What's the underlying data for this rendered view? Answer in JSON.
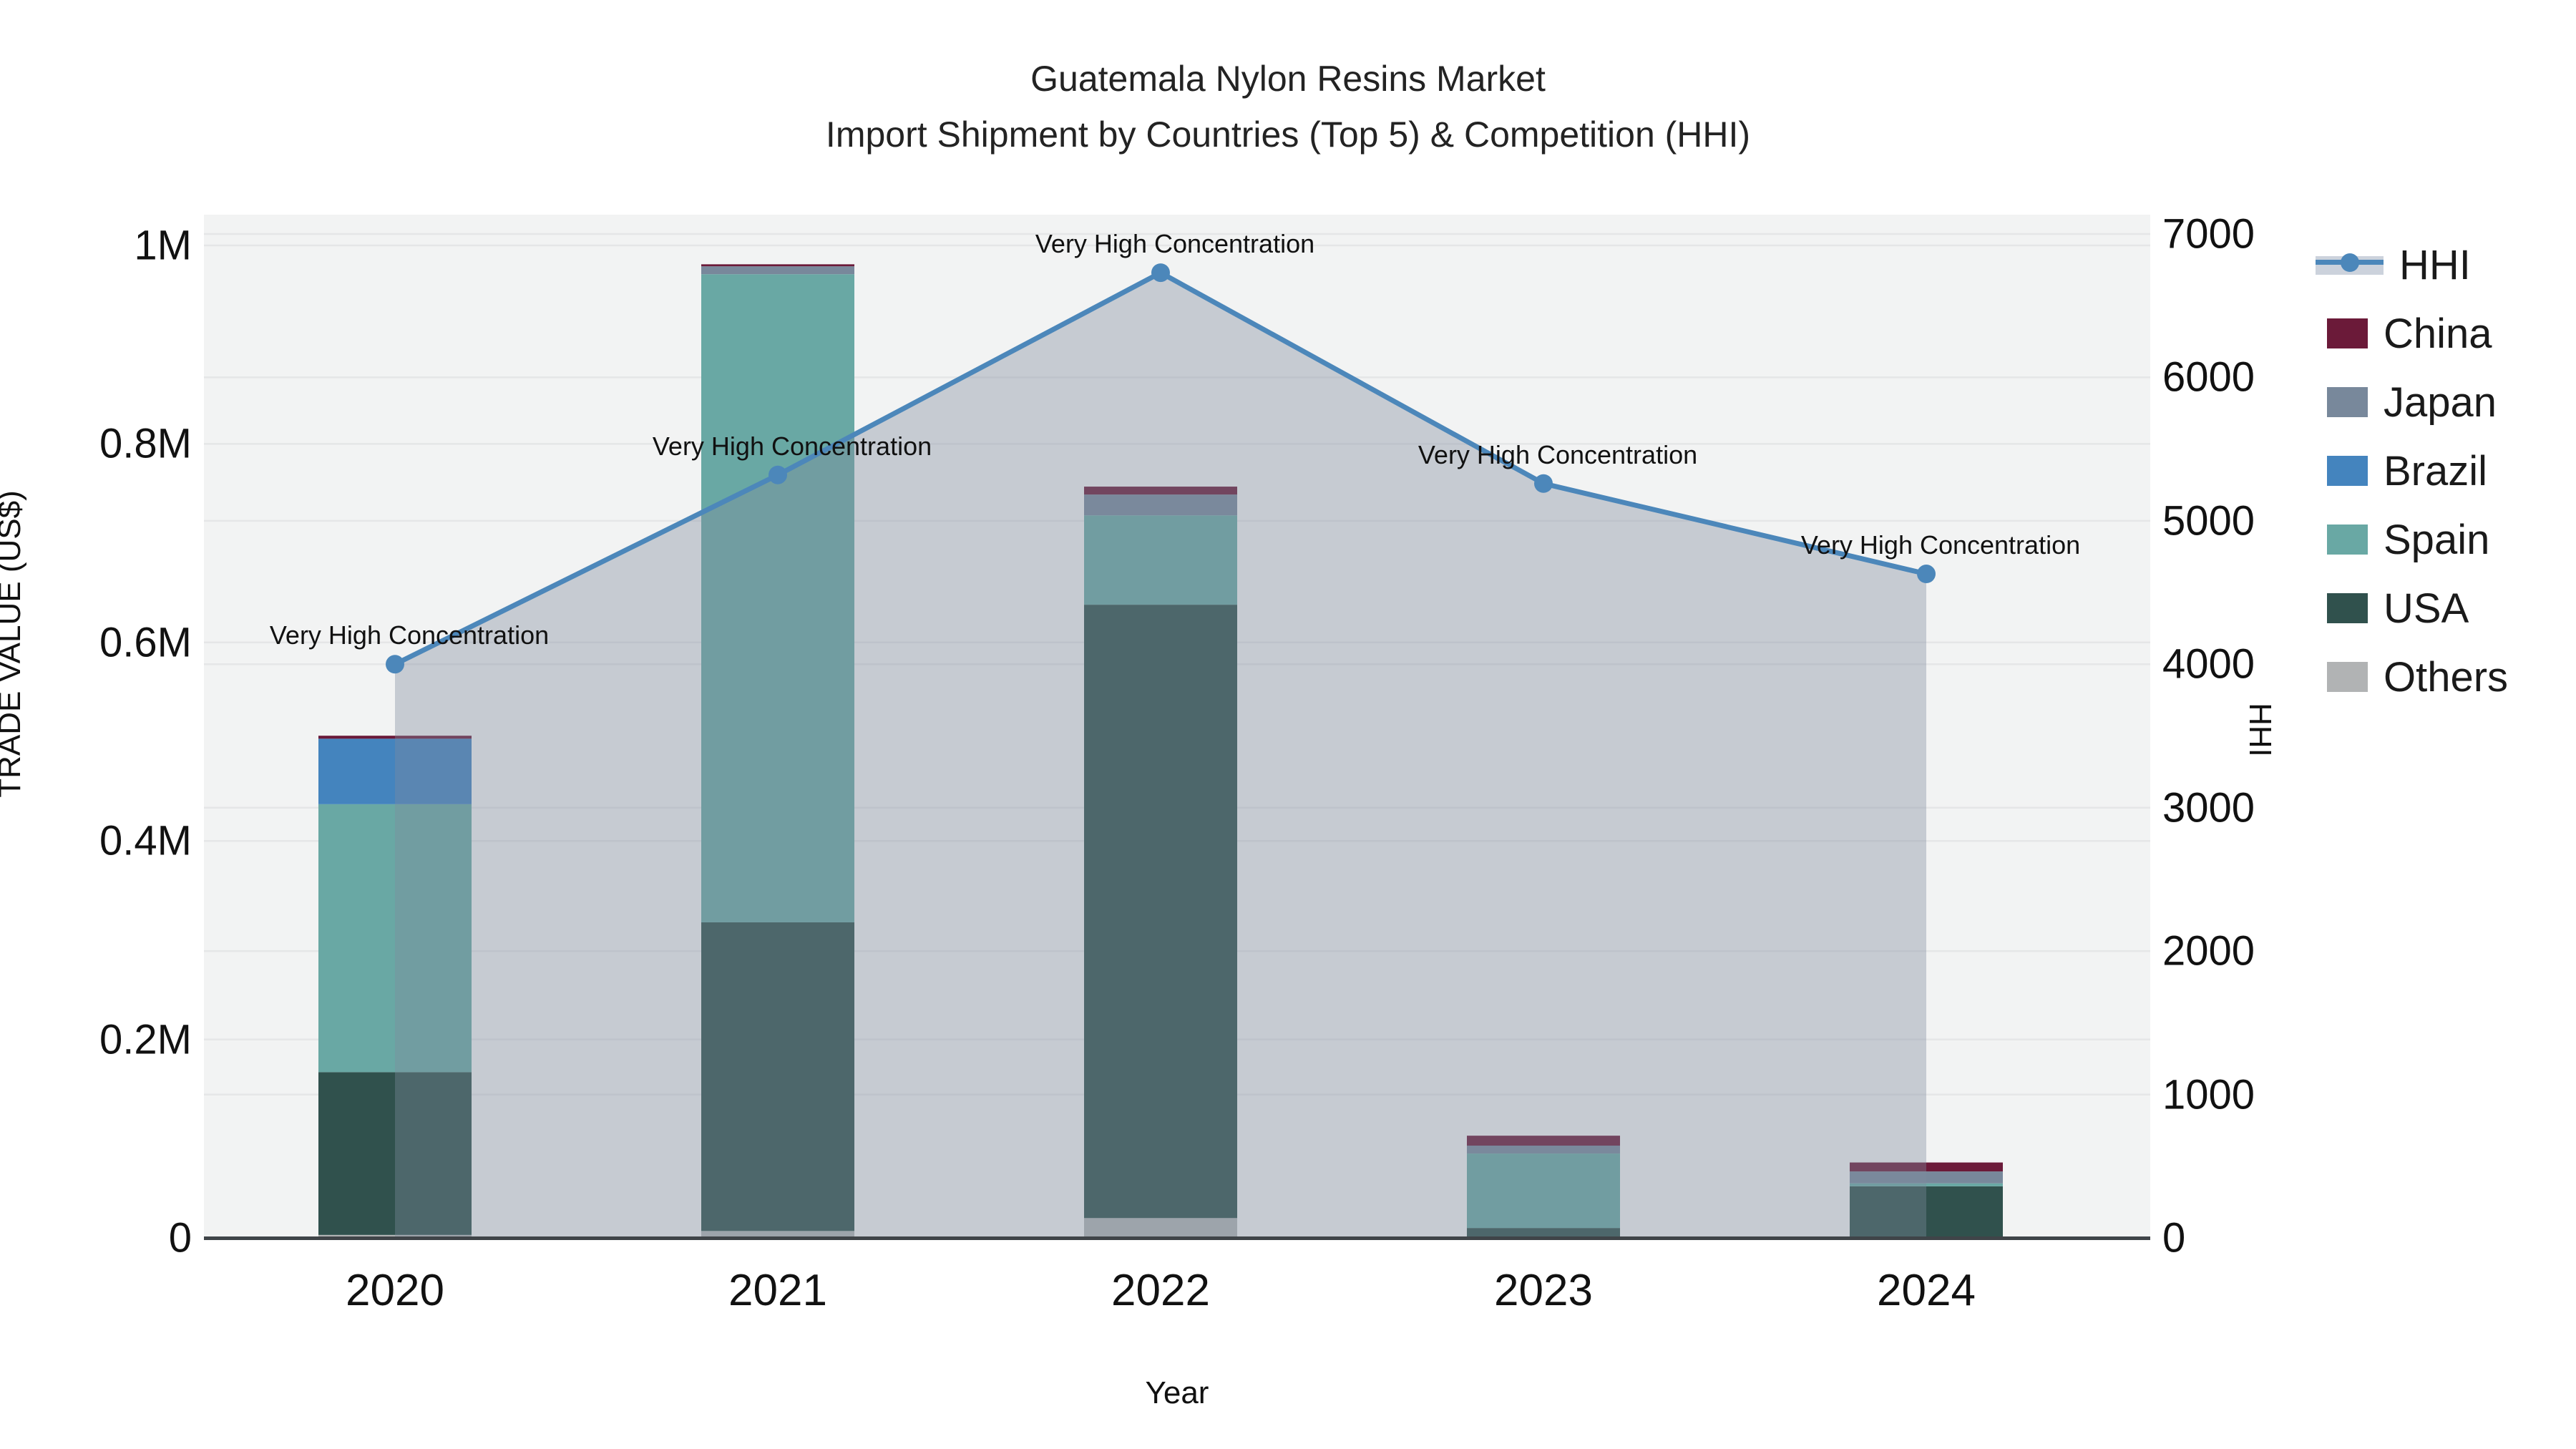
{
  "title": {
    "line1": "Guatemala Nylon Resins Market",
    "line2": "Import Shipment by Countries (Top 5) & Competition (HHI)"
  },
  "axes": {
    "left": {
      "title": "TRADE VALUE (US$)",
      "ticks": [
        "0",
        "0.2M",
        "0.4M",
        "0.6M",
        "0.8M",
        "1M"
      ],
      "tick_values": [
        0,
        200000,
        400000,
        600000,
        800000,
        1000000
      ]
    },
    "right": {
      "title": "HHI",
      "ticks": [
        "0",
        "1000",
        "2000",
        "3000",
        "4000",
        "5000",
        "6000",
        "7000"
      ],
      "tick_values": [
        0,
        1000,
        2000,
        3000,
        4000,
        5000,
        6000,
        7000
      ]
    },
    "x": {
      "title": "Year",
      "ticks": [
        "2020",
        "2021",
        "2022",
        "2023",
        "2024"
      ]
    }
  },
  "legend": {
    "items": [
      {
        "label": "HHI",
        "color": "#4c87ba",
        "type": "line",
        "band_color": "#ccd2dc"
      },
      {
        "label": "China",
        "color": "#6b1a39",
        "type": "swatch"
      },
      {
        "label": "Japan",
        "color": "#78889b",
        "type": "swatch"
      },
      {
        "label": "Brazil",
        "color": "#4484be",
        "type": "swatch"
      },
      {
        "label": "Spain",
        "color": "#69a8a4",
        "type": "swatch"
      },
      {
        "label": "USA",
        "color": "#30514d",
        "type": "swatch"
      },
      {
        "label": "Others",
        "color": "#b1b3b4",
        "type": "swatch"
      }
    ]
  },
  "chart_data": {
    "type": "bar",
    "subtype": "stacked-bars-with-line-overlay",
    "title": "Guatemala Nylon Resins Market — Import Shipment by Countries (Top 5) & Competition (HHI)",
    "categories": [
      "2020",
      "2021",
      "2022",
      "2023",
      "2024"
    ],
    "series": [
      {
        "name": "China",
        "color": "#6b1a39",
        "values": [
          3000,
          2000,
          8000,
          10000,
          9000
        ]
      },
      {
        "name": "Japan",
        "color": "#78889b",
        "values": [
          0,
          8000,
          21000,
          8000,
          12000
        ]
      },
      {
        "name": "Brazil",
        "color": "#4484be",
        "values": [
          66000,
          0,
          0,
          0,
          0
        ]
      },
      {
        "name": "Spain",
        "color": "#69a8a4",
        "values": [
          270000,
          653000,
          90000,
          75000,
          3000
        ]
      },
      {
        "name": "USA",
        "color": "#30514d",
        "values": [
          164000,
          311000,
          618000,
          9000,
          52000
        ]
      },
      {
        "name": "Others",
        "color": "#b1b3b4",
        "values": [
          3000,
          7000,
          20000,
          1000,
          0
        ]
      }
    ],
    "stack_order_bottom_to_top": [
      "Others",
      "USA",
      "Spain",
      "Brazil",
      "Japan",
      "China"
    ],
    "bar_totals": [
      506000,
      981000,
      757000,
      103000,
      76000
    ],
    "line_series": {
      "name": "HHI",
      "color": "#4c87ba",
      "yaxis": "right",
      "values": [
        4000,
        5320,
        6730,
        5260,
        4630
      ],
      "marker": "circle",
      "area_fill": "rgba(126,139,159,0.38)"
    },
    "annotations": [
      {
        "x": "2020",
        "text": "Very High Concentration"
      },
      {
        "x": "2021",
        "text": "Very High Concentration"
      },
      {
        "x": "2022",
        "text": "Very High Concentration"
      },
      {
        "x": "2023",
        "text": "Very High Concentration"
      },
      {
        "x": "2024",
        "text": "Very High Concentration"
      }
    ],
    "xlabel": "Year",
    "ylabel": "TRADE VALUE (US$)",
    "ylabel_right": "HHI",
    "ylim_left": [
      0,
      1000000
    ],
    "ylim_right": [
      0,
      7000
    ],
    "grid": true,
    "legend_position": "right",
    "plot_bg": "#f2f3f3",
    "grid_color": "#e5e6e7",
    "axis_line_color": "#3f4448"
  }
}
